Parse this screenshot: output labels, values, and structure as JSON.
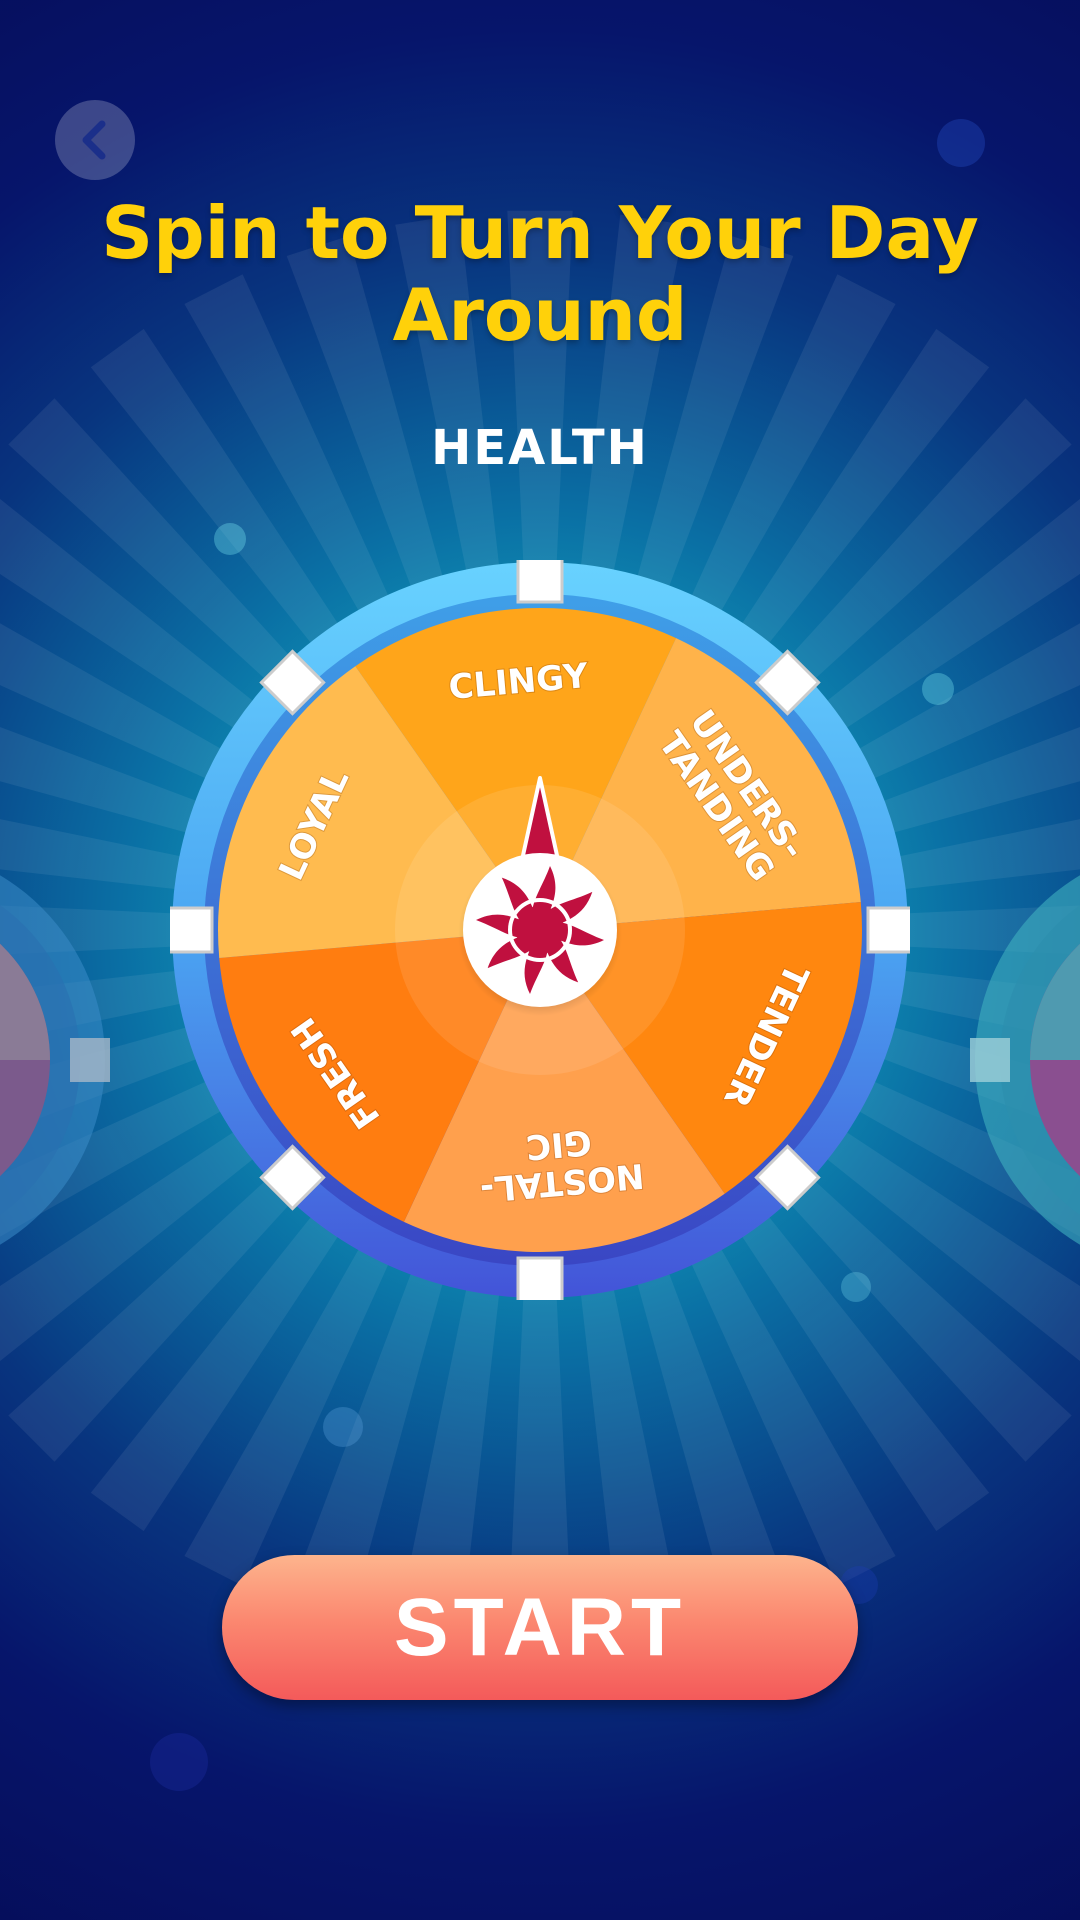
{
  "screen": {
    "title": "Spin to Turn Your Day Around",
    "category": "HEALTH",
    "start_label": "START"
  },
  "wheel": {
    "segments": [
      {
        "label_lines": [
          "CLINGY"
        ],
        "color": "#ffa51a"
      },
      {
        "label_lines": [
          "UNDERS-",
          "TANDING"
        ],
        "color": "#ffb34a"
      },
      {
        "label_lines": [
          "TENDER"
        ],
        "color": "#ff870f"
      },
      {
        "label_lines": [
          "NOSTAL-",
          "GIC"
        ],
        "color": "#ffa04d"
      },
      {
        "label_lines": [
          "FRESH"
        ],
        "color": "#ff7d10"
      },
      {
        "label_lines": [
          "LOYAL"
        ],
        "color": "#ffbb4f"
      }
    ],
    "pointer_color": "#c0103f",
    "hub_icon": "sun-icon"
  },
  "icons": {
    "back": "chevron-left-icon"
  },
  "colors": {
    "title": "#ffd10a",
    "rim_light": "#5cc6ff",
    "rim_dark": "#3e5bd8",
    "start_top": "#fdb48d",
    "start_bottom": "#f45a5a"
  }
}
